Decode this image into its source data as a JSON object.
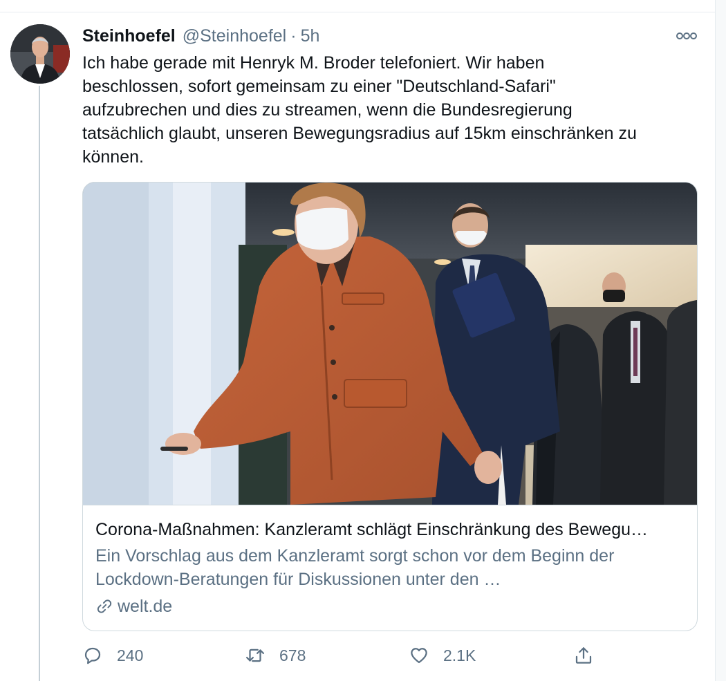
{
  "tweet": {
    "display_name": "Steinhoefel",
    "handle": "@Steinhoefel",
    "separator": "·",
    "timestamp": "5h",
    "text": "Ich habe gerade mit Henryk M. Broder telefoniert. Wir haben\nbeschlossen, sofort gemeinsam zu einer \"Deutschland-Safari\"\naufzubrechen und dies zu streamen, wenn die Bundesregierung\ntatsächlich glaubt, unseren Bewegungsradius auf 15km einschränken zu\nkönnen."
  },
  "card": {
    "title": "Corona-Maßnahmen: Kanzleramt schlägt Einschränkung des Bewegu…",
    "description": "Ein Vorschlag aus dem Kanzleramt sorgt schon vor dem Beginn der Lockdown-Beratungen für Diskussionen unter den …",
    "domain": "welt.de",
    "image": "photo-officials-in-masks-walking-corridor"
  },
  "actions": {
    "reply_count": "240",
    "retweet_count": "678",
    "like_count": "2.1K"
  },
  "icons": {
    "more": "more-icon",
    "reply": "reply-icon",
    "retweet": "retweet-icon",
    "like": "like-icon",
    "share": "share-icon",
    "link": "link-icon"
  },
  "colors": {
    "text": "#0f1419",
    "secondary": "#5b7083",
    "border": "#cfd9de",
    "thread_line": "#c4cfd6"
  }
}
